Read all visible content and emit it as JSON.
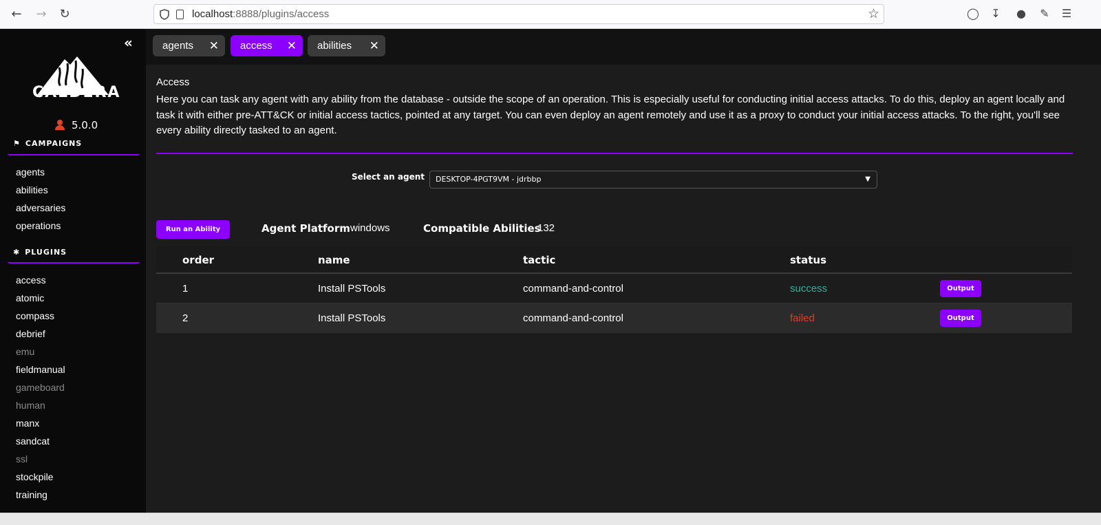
{
  "browser": {
    "url_host": "localhost",
    "url_path": ":8888/plugins/access"
  },
  "sidebar": {
    "brand": "CALDERA",
    "version": "5.0.0",
    "campaigns_header": "CAMPAIGNS",
    "campaigns": [
      "agents",
      "abilities",
      "adversaries",
      "operations"
    ],
    "plugins_header": "PLUGINS",
    "plugins": [
      {
        "label": "access",
        "enabled": true
      },
      {
        "label": "atomic",
        "enabled": true
      },
      {
        "label": "compass",
        "enabled": true
      },
      {
        "label": "debrief",
        "enabled": true
      },
      {
        "label": "emu",
        "enabled": false
      },
      {
        "label": "fieldmanual",
        "enabled": true
      },
      {
        "label": "gameboard",
        "enabled": false
      },
      {
        "label": "human",
        "enabled": false
      },
      {
        "label": "manx",
        "enabled": true
      },
      {
        "label": "sandcat",
        "enabled": true
      },
      {
        "label": "ssl",
        "enabled": false
      },
      {
        "label": "stockpile",
        "enabled": true
      },
      {
        "label": "training",
        "enabled": true
      }
    ]
  },
  "tabs": [
    {
      "label": "agents",
      "active": false
    },
    {
      "label": "access",
      "active": true
    },
    {
      "label": "abilities",
      "active": false
    }
  ],
  "page": {
    "title": "Access",
    "description": "Here you can task any agent with any ability from the database - outside the scope of an operation. This is especially useful for conducting initial access attacks. To do this, deploy an agent locally and task it with either pre-ATT&CK or initial access tactics, pointed at any target. You can even deploy an agent remotely and use it as a proxy to conduct your initial access attacks. To the right, you'll see every ability directly tasked to an agent.",
    "select_label": "Select an agent",
    "selected_agent": "DESKTOP-4PGT9VM - jdrbbp",
    "run_button": "Run an Ability",
    "platform_label": "Agent Platform",
    "platform_value": "windows",
    "compatible_label": "Compatible Abilities",
    "compatible_value": "132"
  },
  "table": {
    "headers": [
      "order",
      "name",
      "tactic",
      "status"
    ],
    "rows": [
      {
        "order": "1",
        "name": "Install PSTools",
        "tactic": "command-and-control",
        "status": "success",
        "button": "Output"
      },
      {
        "order": "2",
        "name": "Install PSTools",
        "tactic": "command-and-control",
        "status": "failed",
        "button": "Output"
      }
    ]
  },
  "colors": {
    "accent": "#8b00ff",
    "success": "#2bb39b",
    "failed": "#d9402a"
  }
}
